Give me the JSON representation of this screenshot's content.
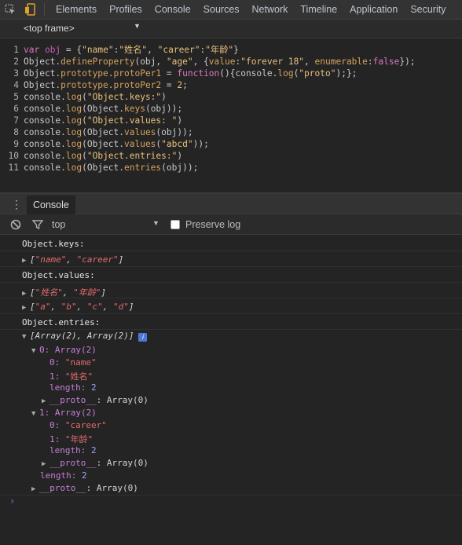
{
  "toolbar": {
    "icons": [
      "inspect-icon",
      "device-icon"
    ],
    "tabs": [
      "Elements",
      "Profiles",
      "Console",
      "Sources",
      "Network",
      "Timeline",
      "Application",
      "Security"
    ]
  },
  "frame_selector": {
    "value": "<top frame>"
  },
  "editor": {
    "lines": [
      "1",
      "2",
      "3",
      "4",
      "5",
      "6",
      "7",
      "8",
      "9",
      "10",
      "11"
    ]
  },
  "drawer": {
    "tab": "Console"
  },
  "console_toolbar": {
    "context": "top",
    "preserve_log": "Preserve log",
    "preserve_checked": false
  },
  "output": {
    "keys_label": "Object.keys:",
    "keys_array_open": "[",
    "keys_array_close": "]",
    "keys_items": [
      "\"name\"",
      "\"career\""
    ],
    "values_label": "Object.values:",
    "values_items1": [
      "\"姓名\"",
      "\"年龄\""
    ],
    "values_items2": [
      "\"a\"",
      "\"b\"",
      "\"c\"",
      "\"d\""
    ],
    "entries_label": "Object.entries:",
    "entries_summary": "[Array(2), Array(2)]",
    "info": "i",
    "e0_head": "0: Array(2)",
    "e0_k0": "0:",
    "e0_v0": "\"name\"",
    "e0_k1": "1:",
    "e0_v1": "\"姓名\"",
    "e0_len_k": "length:",
    "e0_len_v": "2",
    "e0_proto_k": "__proto__",
    "e0_proto_v": ": Array(0)",
    "e1_head": "1: Array(2)",
    "e1_k0": "0:",
    "e1_v0": "\"career\"",
    "e1_k1": "1:",
    "e1_v1": "\"年龄\"",
    "e1_len_k": "length:",
    "e1_len_v": "2",
    "e1_proto_k": "__proto__",
    "e1_proto_v": ": Array(0)",
    "top_len_k": "length:",
    "top_len_v": "2",
    "top_proto_k": "__proto__",
    "top_proto_v": ": Array(0)",
    "prompt": "›"
  }
}
